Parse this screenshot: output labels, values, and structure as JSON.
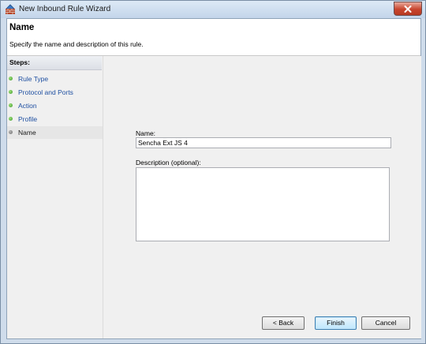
{
  "window": {
    "title": "New Inbound Rule Wizard",
    "close_icon": "close-icon"
  },
  "header": {
    "title": "Name",
    "description": "Specify the name and description of this rule."
  },
  "steps": {
    "title": "Steps:",
    "items": [
      {
        "label": "Rule Type",
        "state": "done"
      },
      {
        "label": "Protocol and Ports",
        "state": "done"
      },
      {
        "label": "Action",
        "state": "done"
      },
      {
        "label": "Profile",
        "state": "done"
      },
      {
        "label": "Name",
        "state": "current"
      }
    ]
  },
  "form": {
    "name_label": "Name:",
    "name_value": "Sencha Ext JS 4",
    "description_label": "Description (optional):",
    "description_value": ""
  },
  "buttons": {
    "back": "< Back",
    "finish": "Finish",
    "cancel": "Cancel"
  }
}
